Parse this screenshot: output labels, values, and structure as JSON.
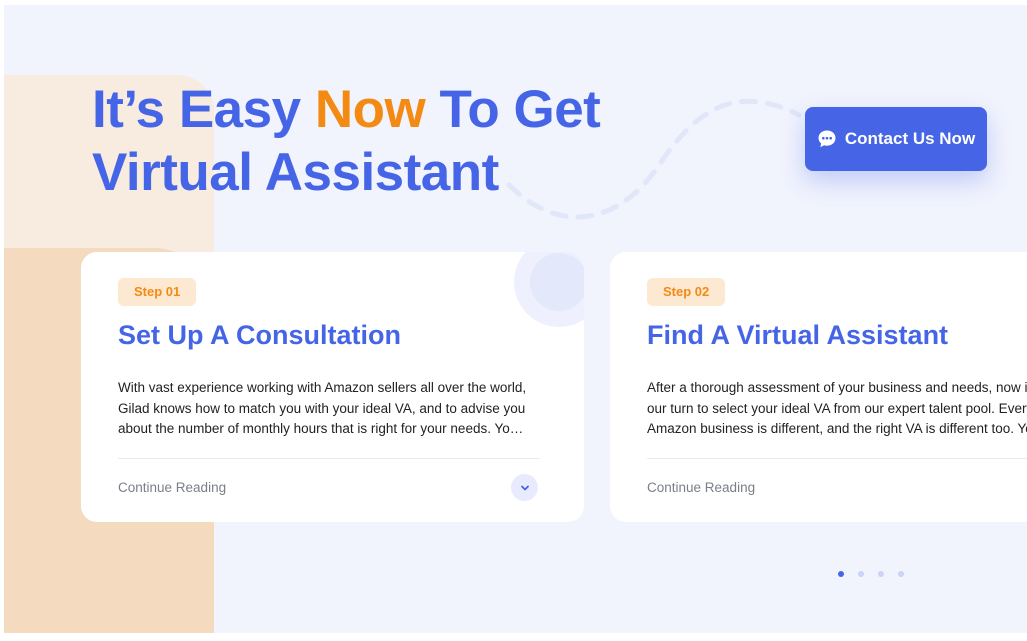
{
  "hero": {
    "headline_part1": "It’s Easy ",
    "headline_accent": "Now",
    "headline_part2": " To Get",
    "headline_line2": "Virtual Assistant"
  },
  "contact_button": {
    "label": "Contact Us Now",
    "icon": "chat-bubble-icon"
  },
  "steps": [
    {
      "badge": "Step 01",
      "title": "Set Up A Consultation",
      "lines": [
        "With vast experience working with Amazon sellers all over the world,",
        "Gilad knows how to match you with your ideal VA, and to advise you",
        "about the number of monthly hours that is right for your needs. You'l..."
      ],
      "link": "Continue Reading",
      "expand_icon": "chevron-down-icon"
    },
    {
      "badge": "Step 02",
      "title": "Find A Virtual Assistant",
      "lines": [
        "After a thorough assessment of your business and needs, now it",
        "our turn to select your ideal VA from our expert talent pool. Every",
        "Amazon business is different, and the right VA is different too. Yo"
      ],
      "link": "Continue Reading"
    }
  ],
  "pagination": {
    "total": 4,
    "active_index": 0
  },
  "colors": {
    "brand_blue": "#4565e6",
    "accent_orange": "#f38a14",
    "section_bg": "#f1f3fd",
    "badge_bg": "#fde9d2",
    "peach": "#f4dbbf"
  }
}
